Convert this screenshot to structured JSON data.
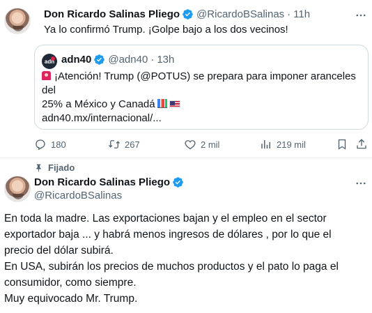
{
  "tweet1": {
    "display_name": "Don Ricardo Salinas Pliego",
    "handle": "@RicardoBSalinas",
    "separator": "·",
    "time": "11h",
    "text": "Ya lo confirmó Trump. ¡Golpe bajo a los dos vecinos!",
    "quote": {
      "avatar_text": "adn",
      "display_name": "adn40",
      "handle": "@adn40",
      "separator": "·",
      "time": "13h",
      "line1": "¡Atención! Trump (@POTUS) se prepara para imponer aranceles del",
      "line2": "25% a México y Canadá",
      "link": "adn40.mx/internacional/..."
    },
    "actions": {
      "replies": "180",
      "reposts": "267",
      "likes": "2 mil",
      "views": "219 mil"
    }
  },
  "tweet2": {
    "pinned_label": "Fijado",
    "display_name": "Don Ricardo Salinas Pliego",
    "handle": "@RicardoBSalinas",
    "lines": [
      "En toda la madre. Las exportaciones bajan y el empleo en el sector",
      "exportador baja ... y habrá menos ingresos de dólares , por lo que el",
      "precio del dólar subirá.",
      "En USA, subirán los precios de muchos productos y el pato lo paga el",
      "consumidor, como siempre.",
      "Muy equivocado Mr. Trump."
    ]
  },
  "colors": {
    "verified_blue": "#1d9bf0",
    "secondary_text": "#536471",
    "border": "#cfd9de"
  },
  "icons": [
    "verified-badge-icon",
    "more-icon",
    "reply-icon",
    "repost-icon",
    "like-icon",
    "views-icon",
    "bookmark-icon",
    "share-icon",
    "pin-icon"
  ]
}
